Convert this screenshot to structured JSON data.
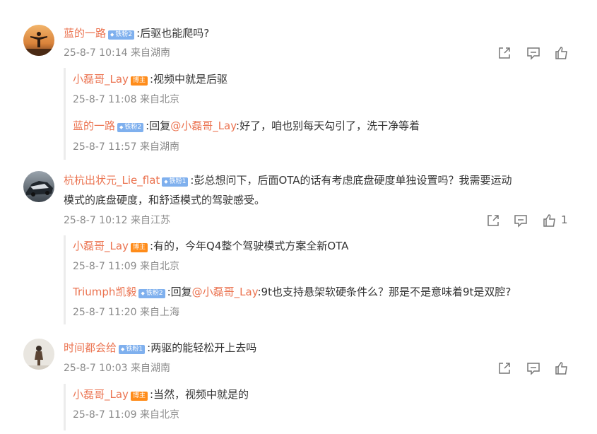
{
  "comments": [
    {
      "user": "蓝的一路",
      "badge": "铁粉2",
      "text": ":后驱也能爬吗?",
      "meta": "25-8-7 10:14 来自湖南",
      "like_count": "",
      "replies": [
        {
          "user": "小磊哥_Lay",
          "badge": "博主",
          "text": ":视频中就是后驱",
          "meta": "25-8-7 11:08 来自北京"
        },
        {
          "user": "蓝的一路",
          "badge": "铁粉2",
          "prefix": ":回复",
          "mention": "@小磊哥_Lay",
          "text": ":好了，咱也别每天勾引了，洗干净等着",
          "meta": "25-8-7 11:57 来自湖南"
        }
      ]
    },
    {
      "user": "杭杭出状元_Lie_flat",
      "badge": "铁粉1",
      "text_line1": ":彭总想问下，后面OTA的话有考虑底盘硬度单独设置吗？我需要运动",
      "text_line2": "模式的底盘硬度，和舒适模式的驾驶感受。",
      "meta": "25-8-7 10:12 来自江苏",
      "like_count": "1",
      "replies": [
        {
          "user": "小磊哥_Lay",
          "badge": "博主",
          "text": ":有的，今年Q4整个驾驶模式方案全新OTA",
          "meta": "25-8-7 11:09 来自北京"
        },
        {
          "user": "Triumph凯毅",
          "badge": "铁粉2",
          "prefix": ":回复",
          "mention": "@小磊哥_Lay",
          "text": ":9t也支持悬架软硬条件么？那是不是意味着9t是双腔?",
          "meta": "25-8-7 11:20 来自上海"
        }
      ]
    },
    {
      "user": "时间都会给",
      "badge": "铁粉1",
      "text": ":两驱的能轻松开上去吗",
      "meta": "25-8-7 10:03 来自湖南",
      "like_count": "",
      "replies": [
        {
          "user": "小磊哥_Lay",
          "badge": "博主",
          "text": ":当然，视频中就是的",
          "meta": "25-8-7 11:09 来自北京"
        }
      ]
    }
  ],
  "icons": {
    "share": "share-icon",
    "comment": "comment-icon",
    "like": "like-icon"
  },
  "colors": {
    "username": "#eb7350",
    "fan_badge": "#7fb0ee",
    "author_badge": "#ff8c1a",
    "meta": "#8a8a8a"
  }
}
